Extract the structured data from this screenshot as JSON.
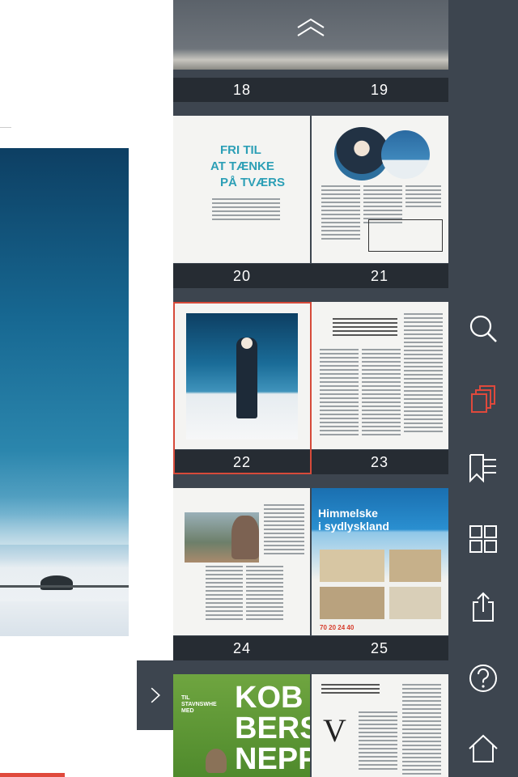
{
  "spreads": [
    {
      "left": "18",
      "right": "19"
    },
    {
      "left": "20",
      "right": "21"
    },
    {
      "left": "22",
      "right": "23"
    },
    {
      "left": "24",
      "right": "25"
    }
  ],
  "page20": {
    "headline_1": "FRI TIL",
    "headline_2": "AT TÆNKE",
    "headline_3": "PÅ TVÆRS"
  },
  "page25": {
    "ad_title_1": "Himmelske",
    "ad_title_2": "i sydlyskland",
    "phone": "70 20 24 40"
  },
  "page26": {
    "headline_1": "KOB",
    "headline_2": "BERS",
    "headline_3": "NEPP",
    "tag": "TIL STAVNSWHE MED"
  },
  "page27": {
    "initial": "V"
  },
  "toolbar": {
    "icons": [
      "search-icon",
      "pages-icon",
      "bookmarks-icon",
      "grid-icon",
      "share-icon",
      "help-icon",
      "home-icon"
    ],
    "active_color": "#e0493c",
    "icon_color": "#ffffff"
  },
  "colors": {
    "panel": "#3d454f",
    "number_bar": "#262c33",
    "selection": "#d64a3a"
  }
}
